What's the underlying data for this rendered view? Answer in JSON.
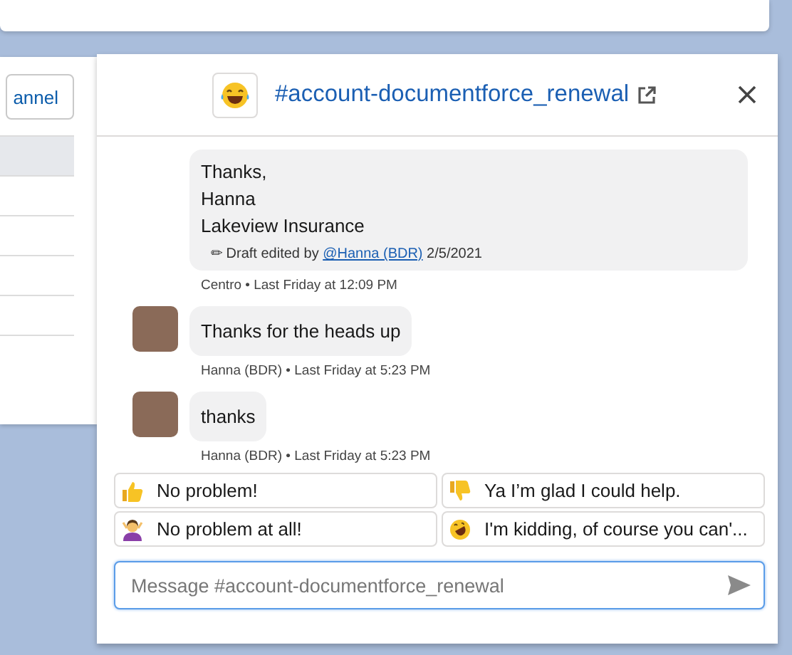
{
  "background_window": {
    "channel_button": "annel",
    "rows": [
      {
        "selected": true
      },
      {
        "selected": false
      },
      {
        "selected": false
      },
      {
        "selected": false
      },
      {
        "selected": false
      },
      {
        "selected": false
      }
    ]
  },
  "chat": {
    "title": "#account-documentforce_renewal",
    "messages": [
      {
        "kind": "outgoing",
        "lines": [
          "Thanks,",
          "Hanna",
          "Lakeview Insurance"
        ],
        "draft_note": {
          "prefix": "✏ Draft edited by",
          "author": "@Hanna (BDR)",
          "date": "2/5/2021"
        },
        "meta": "Centro • Last Friday at 12:09 PM"
      },
      {
        "kind": "incoming",
        "lines": [
          "Thanks for the heads up"
        ],
        "meta": "Hanna (BDR) • Last Friday at 5:23 PM"
      },
      {
        "kind": "incoming",
        "lines": [
          "thanks"
        ],
        "meta": "Hanna (BDR) • Last Friday at 5:23 PM"
      }
    ],
    "quick_replies": [
      {
        "kind": "thumbs-up",
        "text": "No problem!"
      },
      {
        "kind": "thumbs-down",
        "text": "Ya I’m glad I could help."
      },
      {
        "kind": "person",
        "text": "No problem at all!"
      },
      {
        "kind": "rolling-laugh",
        "text": "I'm kidding, of course you can'..."
      }
    ],
    "composer": {
      "placeholder": "Message #account-documentforce_renewal"
    }
  }
}
